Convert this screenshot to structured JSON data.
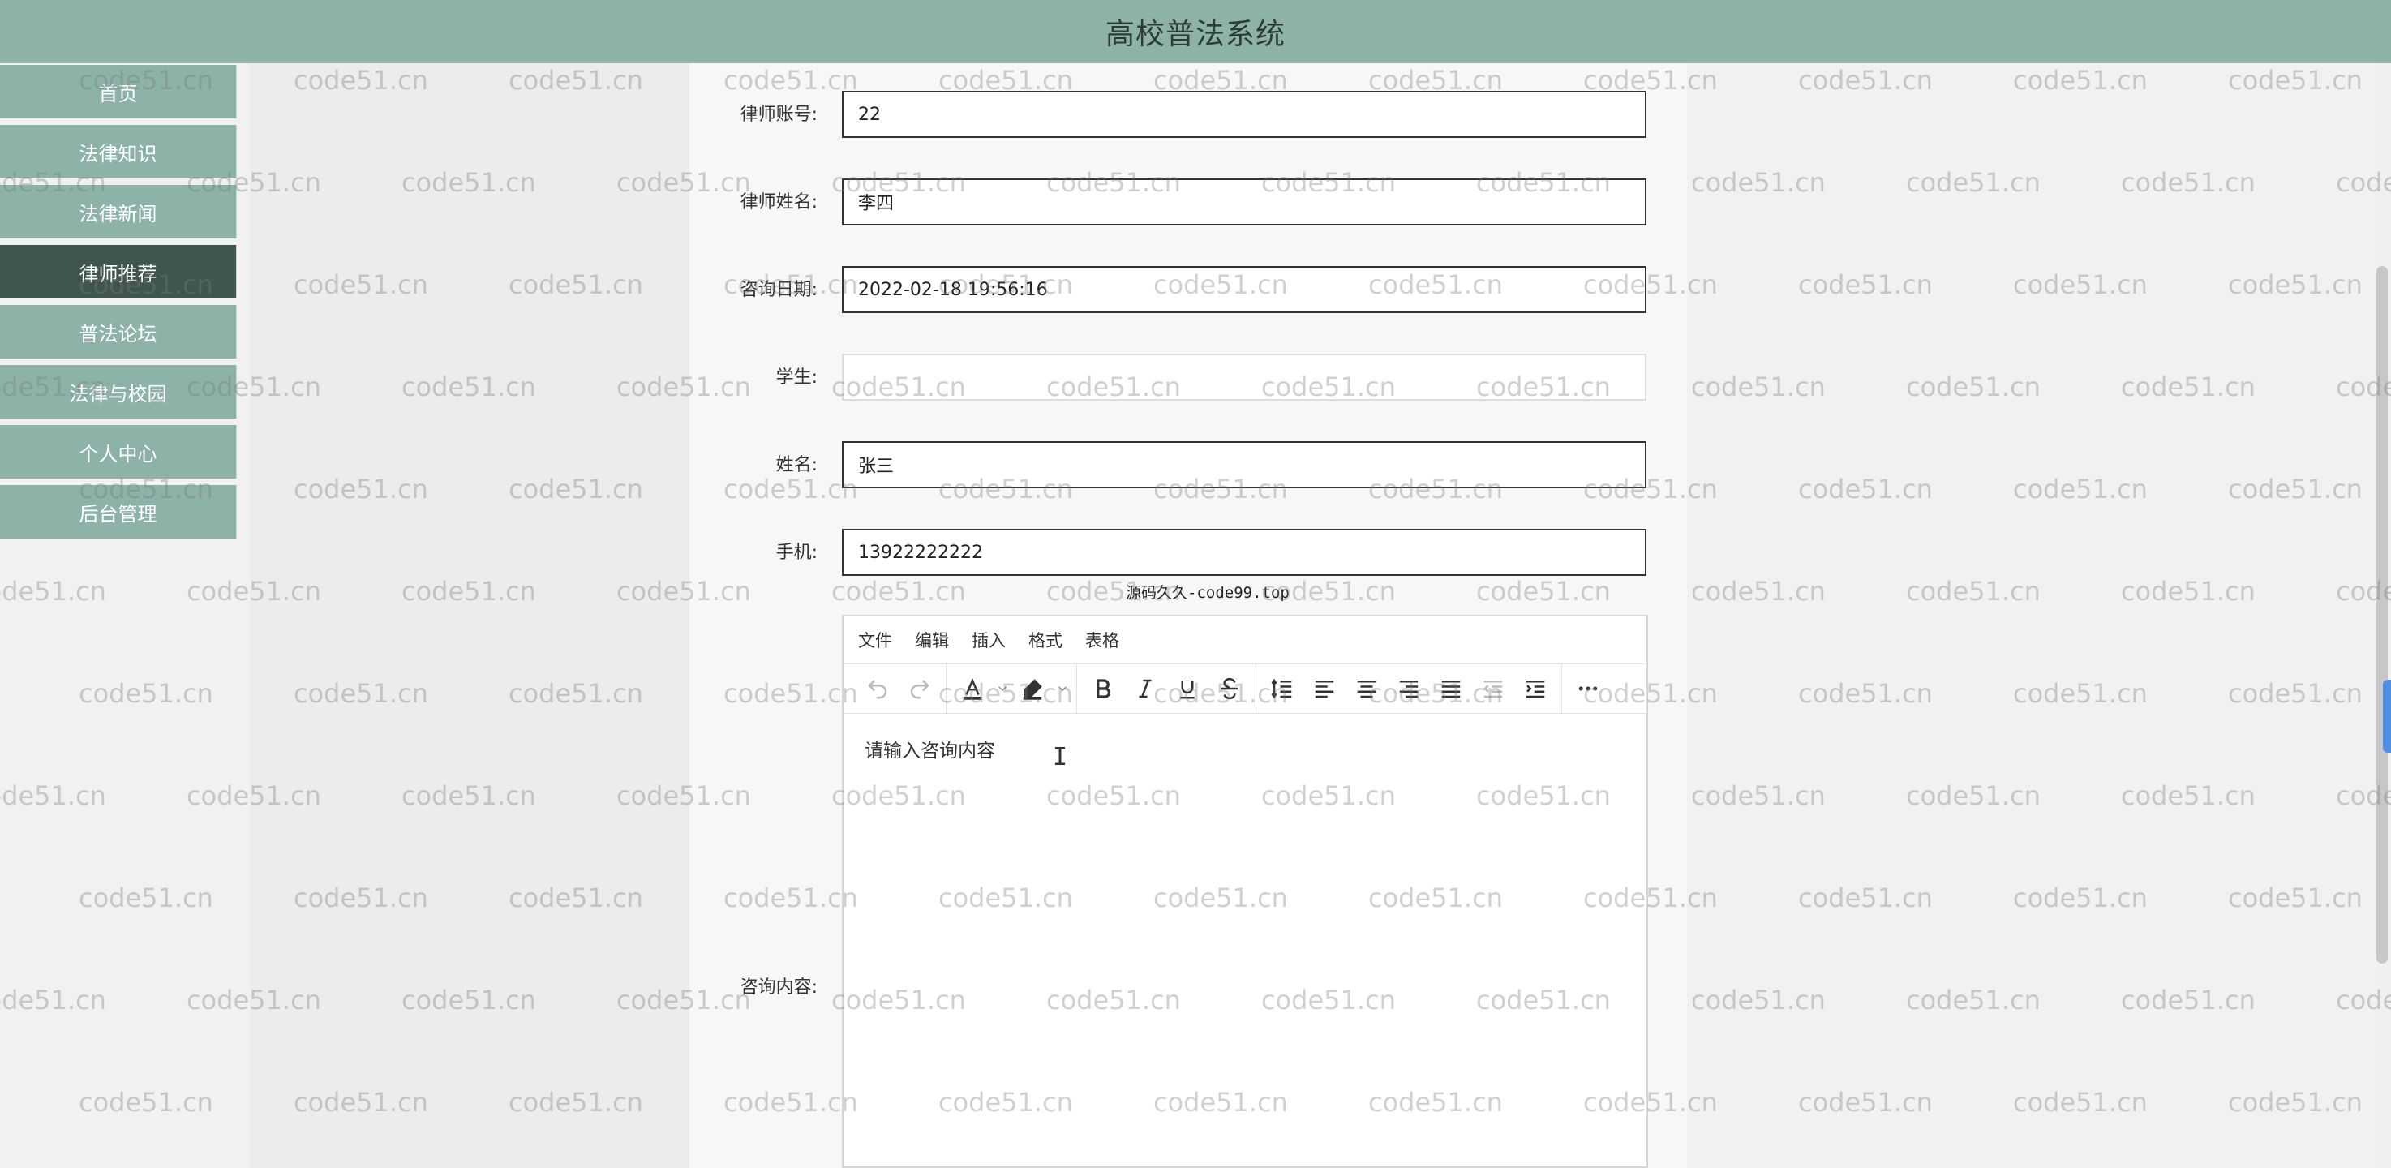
{
  "app": {
    "title": "高校普法系统"
  },
  "nav": {
    "items": [
      {
        "label": "首页"
      },
      {
        "label": "法律知识"
      },
      {
        "label": "法律新闻"
      },
      {
        "label": "律师推荐"
      },
      {
        "label": "普法论坛"
      },
      {
        "label": "法律与校园"
      },
      {
        "label": "个人中心"
      },
      {
        "label": "后台管理"
      }
    ],
    "active": "律师推荐"
  },
  "form": {
    "fields": [
      {
        "label": "律师账号:",
        "value": "22"
      },
      {
        "label": "律师姓名:",
        "value": "李四"
      },
      {
        "label": "咨询日期:",
        "value": "2022-02-18 19:56:16"
      },
      {
        "label": "学生:",
        "value": ""
      },
      {
        "label": "姓名:",
        "value": "张三"
      },
      {
        "label": "手机:",
        "value": "13922222222"
      }
    ],
    "content_label": "咨询内容:"
  },
  "source_note": "源码久久-code99.top",
  "editor": {
    "menu": [
      "文件",
      "编辑",
      "插入",
      "格式",
      "表格"
    ],
    "placeholder": "请输入咨询内容",
    "toolbar_icons": [
      "undo-icon",
      "redo-icon",
      "text-color-icon",
      "highlight-icon",
      "bold-icon",
      "italic-icon",
      "underline-icon",
      "strikethrough-icon",
      "line-height-icon",
      "align-left-icon",
      "align-center-icon",
      "align-right-icon",
      "align-justify-icon",
      "outdent-icon",
      "indent-icon",
      "more-icon"
    ]
  },
  "watermark": {
    "text": "code51.cn"
  },
  "colors": {
    "nav_bg": "#8db3a8",
    "nav_active": "#3f564f",
    "topbar": "#8db3a8"
  }
}
